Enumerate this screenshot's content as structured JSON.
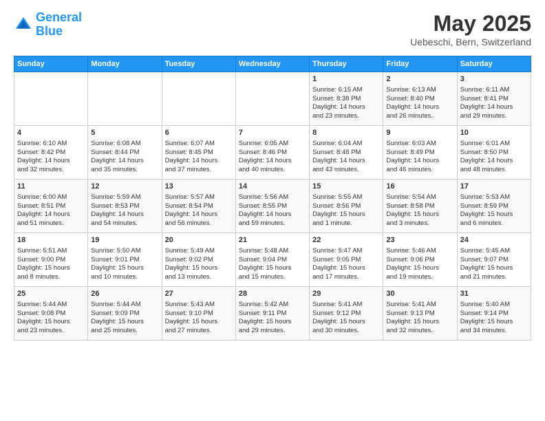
{
  "header": {
    "logo_line1": "General",
    "logo_line2": "Blue",
    "title": "May 2025",
    "subtitle": "Uebeschi, Bern, Switzerland"
  },
  "days_of_week": [
    "Sunday",
    "Monday",
    "Tuesday",
    "Wednesday",
    "Thursday",
    "Friday",
    "Saturday"
  ],
  "weeks": [
    [
      {
        "day": "",
        "content": ""
      },
      {
        "day": "",
        "content": ""
      },
      {
        "day": "",
        "content": ""
      },
      {
        "day": "",
        "content": ""
      },
      {
        "day": "1",
        "content": "Sunrise: 6:15 AM\nSunset: 8:38 PM\nDaylight: 14 hours\nand 23 minutes."
      },
      {
        "day": "2",
        "content": "Sunrise: 6:13 AM\nSunset: 8:40 PM\nDaylight: 14 hours\nand 26 minutes."
      },
      {
        "day": "3",
        "content": "Sunrise: 6:11 AM\nSunset: 8:41 PM\nDaylight: 14 hours\nand 29 minutes."
      }
    ],
    [
      {
        "day": "4",
        "content": "Sunrise: 6:10 AM\nSunset: 8:42 PM\nDaylight: 14 hours\nand 32 minutes."
      },
      {
        "day": "5",
        "content": "Sunrise: 6:08 AM\nSunset: 8:44 PM\nDaylight: 14 hours\nand 35 minutes."
      },
      {
        "day": "6",
        "content": "Sunrise: 6:07 AM\nSunset: 8:45 PM\nDaylight: 14 hours\nand 37 minutes."
      },
      {
        "day": "7",
        "content": "Sunrise: 6:05 AM\nSunset: 8:46 PM\nDaylight: 14 hours\nand 40 minutes."
      },
      {
        "day": "8",
        "content": "Sunrise: 6:04 AM\nSunset: 8:48 PM\nDaylight: 14 hours\nand 43 minutes."
      },
      {
        "day": "9",
        "content": "Sunrise: 6:03 AM\nSunset: 8:49 PM\nDaylight: 14 hours\nand 46 minutes."
      },
      {
        "day": "10",
        "content": "Sunrise: 6:01 AM\nSunset: 8:50 PM\nDaylight: 14 hours\nand 48 minutes."
      }
    ],
    [
      {
        "day": "11",
        "content": "Sunrise: 6:00 AM\nSunset: 8:51 PM\nDaylight: 14 hours\nand 51 minutes."
      },
      {
        "day": "12",
        "content": "Sunrise: 5:59 AM\nSunset: 8:53 PM\nDaylight: 14 hours\nand 54 minutes."
      },
      {
        "day": "13",
        "content": "Sunrise: 5:57 AM\nSunset: 8:54 PM\nDaylight: 14 hours\nand 56 minutes."
      },
      {
        "day": "14",
        "content": "Sunrise: 5:56 AM\nSunset: 8:55 PM\nDaylight: 14 hours\nand 59 minutes."
      },
      {
        "day": "15",
        "content": "Sunrise: 5:55 AM\nSunset: 8:56 PM\nDaylight: 15 hours\nand 1 minute."
      },
      {
        "day": "16",
        "content": "Sunrise: 5:54 AM\nSunset: 8:58 PM\nDaylight: 15 hours\nand 3 minutes."
      },
      {
        "day": "17",
        "content": "Sunrise: 5:53 AM\nSunset: 8:59 PM\nDaylight: 15 hours\nand 6 minutes."
      }
    ],
    [
      {
        "day": "18",
        "content": "Sunrise: 5:51 AM\nSunset: 9:00 PM\nDaylight: 15 hours\nand 8 minutes."
      },
      {
        "day": "19",
        "content": "Sunrise: 5:50 AM\nSunset: 9:01 PM\nDaylight: 15 hours\nand 10 minutes."
      },
      {
        "day": "20",
        "content": "Sunrise: 5:49 AM\nSunset: 9:02 PM\nDaylight: 15 hours\nand 13 minutes."
      },
      {
        "day": "21",
        "content": "Sunrise: 5:48 AM\nSunset: 9:04 PM\nDaylight: 15 hours\nand 15 minutes."
      },
      {
        "day": "22",
        "content": "Sunrise: 5:47 AM\nSunset: 9:05 PM\nDaylight: 15 hours\nand 17 minutes."
      },
      {
        "day": "23",
        "content": "Sunrise: 5:46 AM\nSunset: 9:06 PM\nDaylight: 15 hours\nand 19 minutes."
      },
      {
        "day": "24",
        "content": "Sunrise: 5:45 AM\nSunset: 9:07 PM\nDaylight: 15 hours\nand 21 minutes."
      }
    ],
    [
      {
        "day": "25",
        "content": "Sunrise: 5:44 AM\nSunset: 9:08 PM\nDaylight: 15 hours\nand 23 minutes."
      },
      {
        "day": "26",
        "content": "Sunrise: 5:44 AM\nSunset: 9:09 PM\nDaylight: 15 hours\nand 25 minutes."
      },
      {
        "day": "27",
        "content": "Sunrise: 5:43 AM\nSunset: 9:10 PM\nDaylight: 15 hours\nand 27 minutes."
      },
      {
        "day": "28",
        "content": "Sunrise: 5:42 AM\nSunset: 9:11 PM\nDaylight: 15 hours\nand 29 minutes."
      },
      {
        "day": "29",
        "content": "Sunrise: 5:41 AM\nSunset: 9:12 PM\nDaylight: 15 hours\nand 30 minutes."
      },
      {
        "day": "30",
        "content": "Sunrise: 5:41 AM\nSunset: 9:13 PM\nDaylight: 15 hours\nand 32 minutes."
      },
      {
        "day": "31",
        "content": "Sunrise: 5:40 AM\nSunset: 9:14 PM\nDaylight: 15 hours\nand 34 minutes."
      }
    ]
  ]
}
